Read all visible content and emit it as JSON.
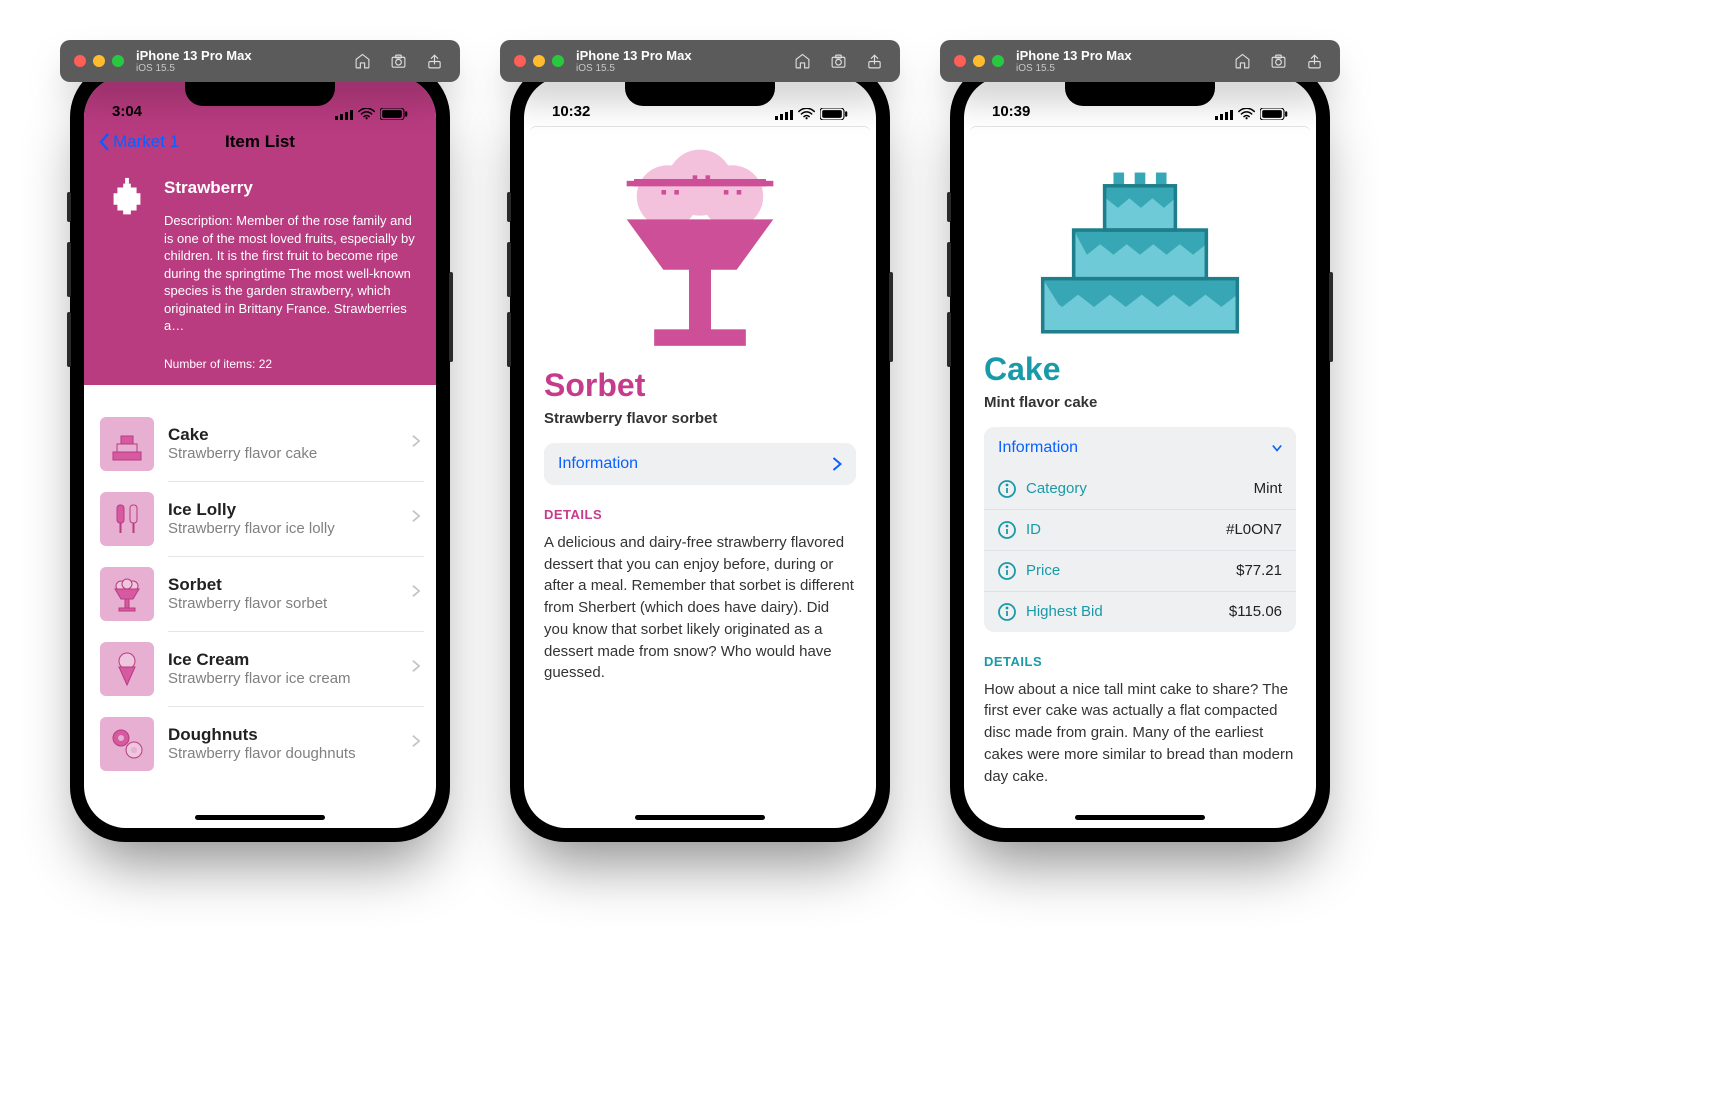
{
  "simulator": {
    "device": "iPhone 13 Pro Max",
    "os": "iOS 15.5"
  },
  "screen1": {
    "statusbar": {
      "time": "3:04"
    },
    "nav": {
      "back": "Market 1",
      "title": "Item List"
    },
    "header": {
      "name": "Strawberry",
      "description": "Description: Member of the rose family and is one of the most loved fruits, especially by children.  It is the first fruit to become ripe during the springtime The most well-known species is the garden strawberry, which originated in Brittany France.  Strawberries a…",
      "count_label": "Number of items: 22"
    },
    "items": [
      {
        "title": "Cake",
        "subtitle": "Strawberry flavor cake",
        "icon": "cake"
      },
      {
        "title": "Ice Lolly",
        "subtitle": "Strawberry flavor ice lolly",
        "icon": "lolly"
      },
      {
        "title": "Sorbet",
        "subtitle": "Strawberry flavor sorbet",
        "icon": "sorbet"
      },
      {
        "title": "Ice Cream",
        "subtitle": "Strawberry flavor ice cream",
        "icon": "icecream"
      },
      {
        "title": "Doughnuts",
        "subtitle": "Strawberry flavor doughnuts",
        "icon": "doughnut"
      }
    ]
  },
  "screen2": {
    "statusbar": {
      "time": "10:32"
    },
    "title": "Sorbet",
    "subtitle": "Strawberry flavor sorbet",
    "info_button": "Information",
    "details_label": "DETAILS",
    "details_body": "A delicious and dairy-free strawberry flavored dessert that you can enjoy before, during or after a meal.  Remember that sorbet is different from Sherbert (which does have dairy).  Did you know that sorbet likely originated as a dessert made from snow?  Who would have guessed.",
    "accent_hex": "#c63c8c"
  },
  "screen3": {
    "statusbar": {
      "time": "10:39"
    },
    "title": "Cake",
    "subtitle": "Mint flavor cake",
    "info_button": "Information",
    "info_rows": [
      {
        "label": "Category",
        "value": "Mint"
      },
      {
        "label": "ID",
        "value": "#L0ON7"
      },
      {
        "label": "Price",
        "value": "$77.21"
      },
      {
        "label": "Highest Bid",
        "value": "$115.06"
      }
    ],
    "details_label": "DETAILS",
    "details_body": "How about a nice tall mint cake to share?  The first ever cake was actually a flat compacted disc made from grain.  Many of the earliest cakes were more similar to bread than modern day cake.",
    "accent_hex": "#199aa8"
  }
}
